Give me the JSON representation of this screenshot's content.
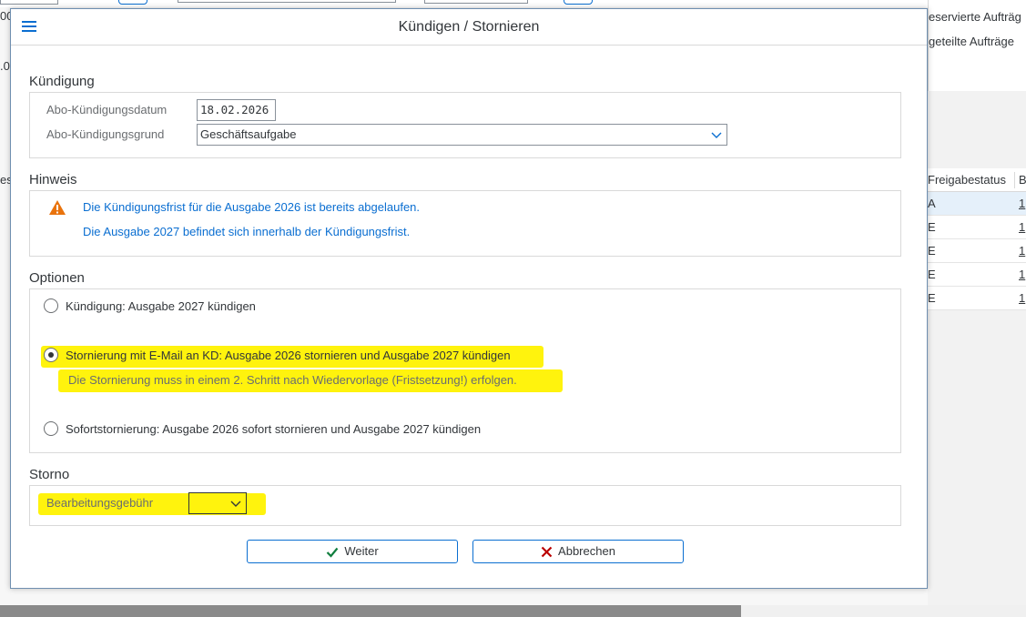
{
  "background": {
    "right_panel_items": [
      "eservierte Aufträg",
      "geteilte Aufträge"
    ],
    "table_header": [
      "Freigabestatus",
      "B"
    ],
    "table_rows": [
      {
        "a": "A",
        "b": "1"
      },
      {
        "a": "E",
        "b": "1"
      },
      {
        "a": "E",
        "b": "1"
      },
      {
        "a": "E",
        "b": "1"
      },
      {
        "a": "E",
        "b": "1"
      }
    ],
    "left_fragments": [
      "00",
      ".0",
      "es"
    ]
  },
  "dialog": {
    "title": "Kündigen / Stornieren",
    "kuendigung": {
      "section_title": "Kündigung",
      "date_label": "Abo-Kündigungsdatum",
      "date_value": "18.02.2026",
      "reason_label": "Abo-Kündigungsgrund",
      "reason_value": "Geschäftsaufgabe"
    },
    "hinweis": {
      "section_title": "Hinweis",
      "icon": "warning-icon",
      "line1": "Die Kündigungsfrist für die Ausgabe 2026 ist bereits abgelaufen.",
      "line2": "Die Ausgabe 2027 befindet sich innerhalb der Kündigungsfrist."
    },
    "optionen": {
      "section_title": "Optionen",
      "option1": "Kündigung: Ausgabe 2027 kündigen",
      "option2": "Stornierung mit E-Mail an KD: Ausgabe 2026 stornieren und Ausgabe 2027 kündigen",
      "option2_note": "Die Stornierung muss in einem 2. Schritt nach Wiedervorlage (Fristsetzung!) erfolgen.",
      "option3": "Sofortstornierung: Ausgabe 2026 sofort stornieren und Ausgabe 2027 kündigen",
      "selected": "option2"
    },
    "storno": {
      "section_title": "Storno",
      "fee_label": "Bearbeitungsgebühr",
      "fee_value": ""
    },
    "buttons": {
      "continue_label": "Weiter",
      "cancel_label": "Abbrechen"
    }
  },
  "colors": {
    "accent": "#0a6ed1",
    "highlight": "#fff200",
    "warning": "#e9730c",
    "ok": "#107e3e",
    "cancel": "#bb0000"
  }
}
